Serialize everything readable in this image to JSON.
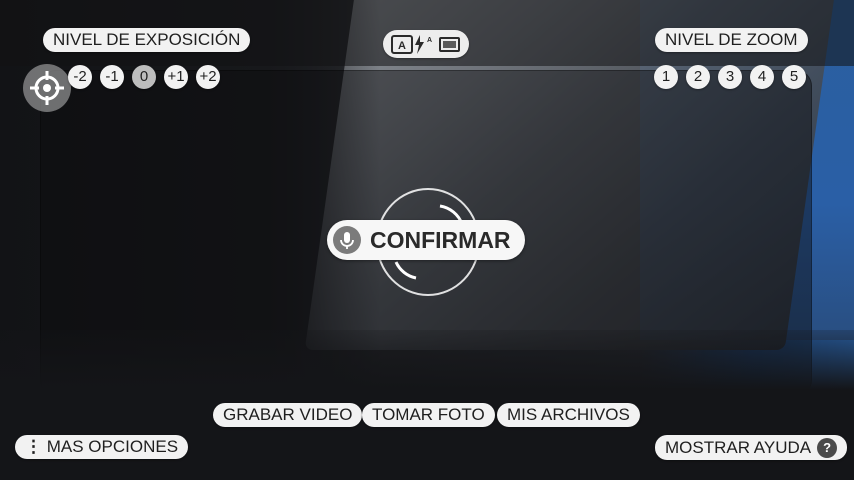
{
  "exposure": {
    "title": "NIVEL DE EXPOSICIÓN",
    "levels": [
      "-2",
      "-1",
      "0",
      "+1",
      "+2"
    ]
  },
  "zoom": {
    "title": "NIVEL DE ZOOM",
    "levels": [
      "1",
      "2",
      "3",
      "4",
      "5"
    ]
  },
  "center": {
    "confirm_label": "CONFIRMAR"
  },
  "actions": {
    "record": "GRABAR VIDEO",
    "photo": "TOMAR FOTO",
    "files": "MIS ARCHIVOS"
  },
  "more_options": "MAS OPCIONES",
  "show_help": "MOSTRAR AYUDA",
  "help_icon": "?"
}
